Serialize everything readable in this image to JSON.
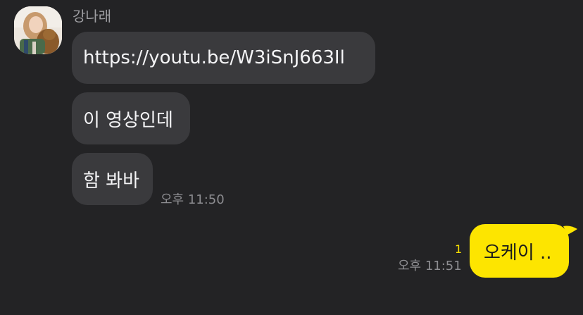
{
  "chat": {
    "sender_name": "강나래",
    "incoming": [
      {
        "text": "https://youtu.be/W3iSnJ663Il"
      },
      {
        "text": "이 영상인데"
      },
      {
        "text": "함 봐바"
      }
    ],
    "incoming_time": "오후 11:50",
    "outgoing": {
      "text": "오케이 ..",
      "time": "오후 11:51",
      "unread_count": "1"
    }
  },
  "colors": {
    "background": "#232325",
    "incoming_bubble": "#3a3a3d",
    "outgoing_bubble": "#fde500",
    "unread": "#f7df00"
  },
  "icons": {
    "avatar": "profile-photo-avatar"
  }
}
